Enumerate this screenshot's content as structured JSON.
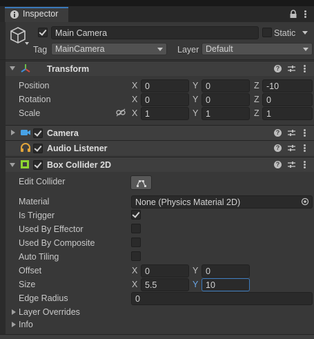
{
  "tab": {
    "label": "Inspector",
    "icon": "info-icon"
  },
  "object": {
    "name": "Main Camera",
    "active": true,
    "static_label": "Static",
    "static": false,
    "tag_label": "Tag",
    "tag_value": "MainCamera",
    "layer_label": "Layer",
    "layer_value": "Default"
  },
  "transform": {
    "title": "Transform",
    "rows": [
      {
        "label": "Position",
        "x": "0",
        "y": "0",
        "z": "-10"
      },
      {
        "label": "Rotation",
        "x": "0",
        "y": "0",
        "z": "0"
      },
      {
        "label": "Scale",
        "x": "1",
        "y": "1",
        "z": "1"
      }
    ],
    "axes": {
      "x": "X",
      "y": "Y",
      "z": "Z"
    }
  },
  "camera": {
    "title": "Camera",
    "enabled": true
  },
  "audio_listener": {
    "title": "Audio Listener",
    "enabled": true
  },
  "box_collider": {
    "title": "Box Collider 2D",
    "enabled": true,
    "edit_collider_label": "Edit Collider",
    "material_label": "Material",
    "material_value": "None (Physics Material 2D)",
    "is_trigger_label": "Is Trigger",
    "is_trigger": true,
    "used_by_effector_label": "Used By Effector",
    "used_by_composite_label": "Used By Composite",
    "auto_tiling_label": "Auto Tiling",
    "offset_label": "Offset",
    "offset_x": "0",
    "offset_y": "0",
    "size_label": "Size",
    "size_x": "5.5",
    "size_y": "10",
    "edge_radius_label": "Edge Radius",
    "edge_radius": "0",
    "layer_overrides_label": "Layer Overrides",
    "info_label": "Info"
  },
  "colors": {
    "accent": "#3a79bb",
    "panel": "#383838",
    "header": "#3e3e3e"
  }
}
